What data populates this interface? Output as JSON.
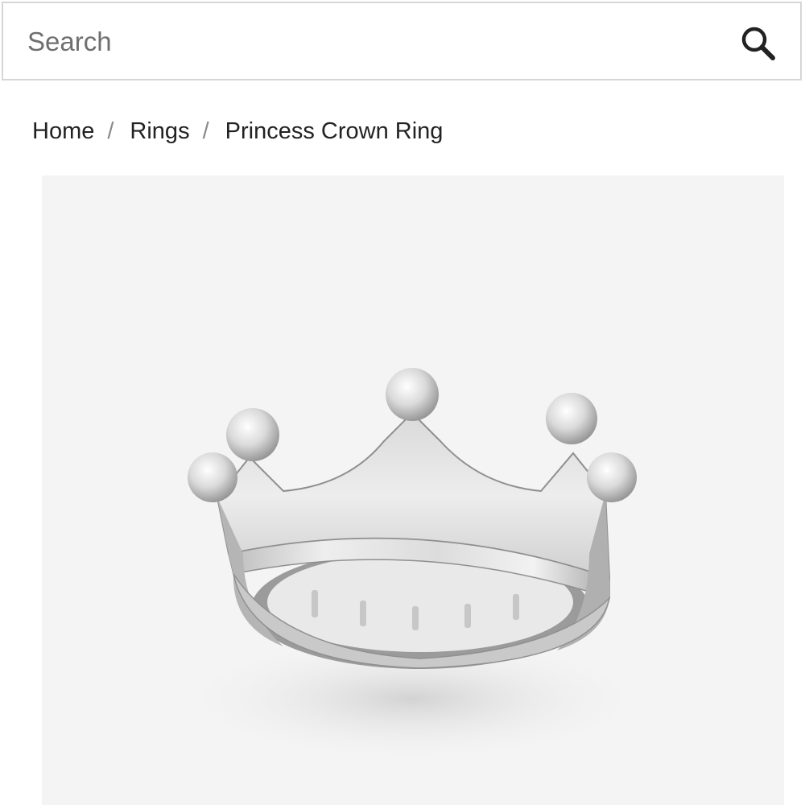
{
  "search": {
    "placeholder": "Search",
    "value": "",
    "icon": "search-icon"
  },
  "breadcrumb": {
    "items": [
      {
        "label": "Home"
      },
      {
        "label": "Rings"
      },
      {
        "label": "Princess Crown Ring"
      }
    ],
    "separator": "/"
  },
  "product": {
    "image_background": "#f4f4f4"
  }
}
